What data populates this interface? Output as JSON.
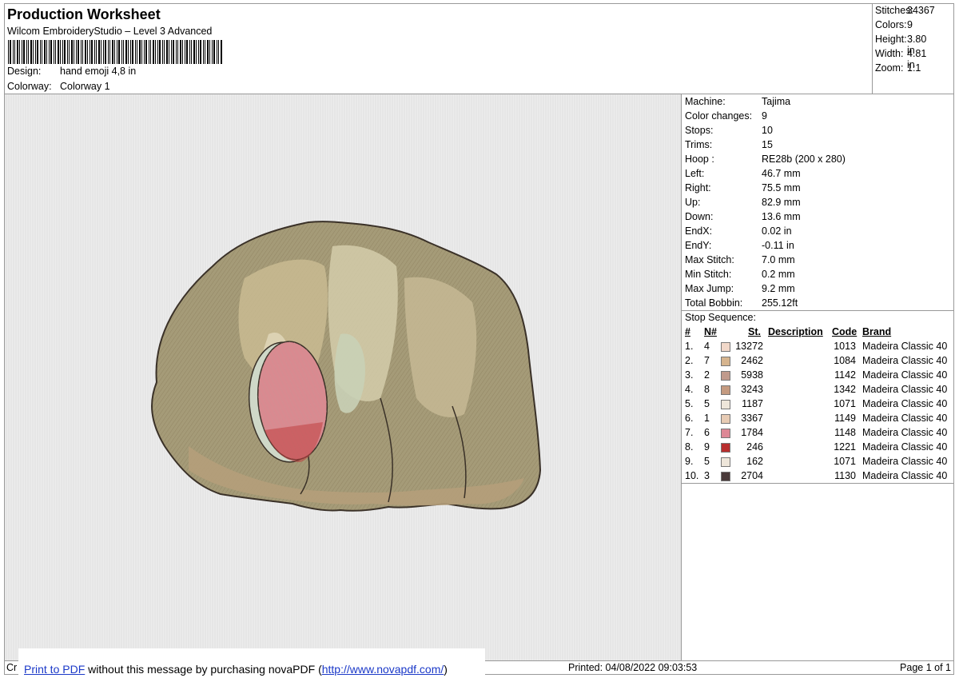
{
  "header": {
    "title": "Production Worksheet",
    "software": "Wilcom EmbroideryStudio – Level 3 Advanced",
    "design_label": "Design:",
    "design_value": "hand emoji 4,8 in",
    "colorway_label": "Colorway:",
    "colorway_value": "Colorway 1"
  },
  "summary": [
    {
      "label": "Stitches:",
      "value": "34367"
    },
    {
      "label": "Colors:",
      "value": "9"
    },
    {
      "label": "Height:",
      "value": "3.80 in"
    },
    {
      "label": "Width:",
      "value": "4.81 in"
    },
    {
      "label": "Zoom:",
      "value": "1:1"
    }
  ],
  "machine_info": [
    {
      "label": "Machine:",
      "value": "Tajima"
    },
    {
      "label": "Color changes:",
      "value": "9"
    },
    {
      "label": "Stops:",
      "value": "10"
    },
    {
      "label": "Trims:",
      "value": "15"
    },
    {
      "label": "Hoop :",
      "value": "RE28b (200 x 280)"
    },
    {
      "label": "Left:",
      "value": "46.7 mm"
    },
    {
      "label": "Right:",
      "value": "75.5 mm"
    },
    {
      "label": "Up:",
      "value": "82.9 mm"
    },
    {
      "label": "Down:",
      "value": "13.6 mm"
    },
    {
      "label": "EndX:",
      "value": "0.02 in"
    },
    {
      "label": "EndY:",
      "value": "-0.11 in"
    },
    {
      "label": "Max Stitch:",
      "value": "7.0 mm"
    },
    {
      "label": "Min Stitch:",
      "value": "0.2 mm"
    },
    {
      "label": "Max Jump:",
      "value": "9.2 mm"
    },
    {
      "label": "Total Bobbin:",
      "value": "255.12ft"
    }
  ],
  "stop_sequence": {
    "title": "Stop Sequence:",
    "headers": {
      "num": "#",
      "n": "N#",
      "st": "St.",
      "desc": "Description",
      "code": "Code",
      "brand": "Brand"
    },
    "rows": [
      {
        "num": "1.",
        "n": "4",
        "color": "#f1d8c9",
        "st": "13272",
        "desc": "",
        "code": "1013",
        "brand": "Madeira Classic 40"
      },
      {
        "num": "2.",
        "n": "7",
        "color": "#d6b48e",
        "st": "2462",
        "desc": "",
        "code": "1084",
        "brand": "Madeira Classic 40"
      },
      {
        "num": "3.",
        "n": "2",
        "color": "#c09a8c",
        "st": "5938",
        "desc": "",
        "code": "1142",
        "brand": "Madeira Classic 40"
      },
      {
        "num": "4.",
        "n": "8",
        "color": "#c49a80",
        "st": "3243",
        "desc": "",
        "code": "1342",
        "brand": "Madeira Classic 40"
      },
      {
        "num": "5.",
        "n": "5",
        "color": "#eee6da",
        "st": "1187",
        "desc": "",
        "code": "1071",
        "brand": "Madeira Classic 40"
      },
      {
        "num": "6.",
        "n": "1",
        "color": "#e7cbb4",
        "st": "3367",
        "desc": "",
        "code": "1149",
        "brand": "Madeira Classic 40"
      },
      {
        "num": "7.",
        "n": "6",
        "color": "#dd8896",
        "st": "1784",
        "desc": "",
        "code": "1148",
        "brand": "Madeira Classic 40"
      },
      {
        "num": "8.",
        "n": "9",
        "color": "#b82e2e",
        "st": "246",
        "desc": "",
        "code": "1221",
        "brand": "Madeira Classic 40"
      },
      {
        "num": "9.",
        "n": "5",
        "color": "#eee6da",
        "st": "162",
        "desc": "",
        "code": "1071",
        "brand": "Madeira Classic 40"
      },
      {
        "num": "10.",
        "n": "3",
        "color": "#4a3a3a",
        "st": "2704",
        "desc": "",
        "code": "1130",
        "brand": "Madeira Classic 40"
      }
    ]
  },
  "footer": {
    "cr": "Cr",
    "pdf_link": "Print to PDF",
    "pdf_text": " without this message by purchasing novaPDF (",
    "pdf_url": "http://www.novapdf.com/",
    "pdf_close": ")",
    "printed": "Printed: 04/08/2022 09:03:53",
    "page": "Page 1 of 1"
  }
}
